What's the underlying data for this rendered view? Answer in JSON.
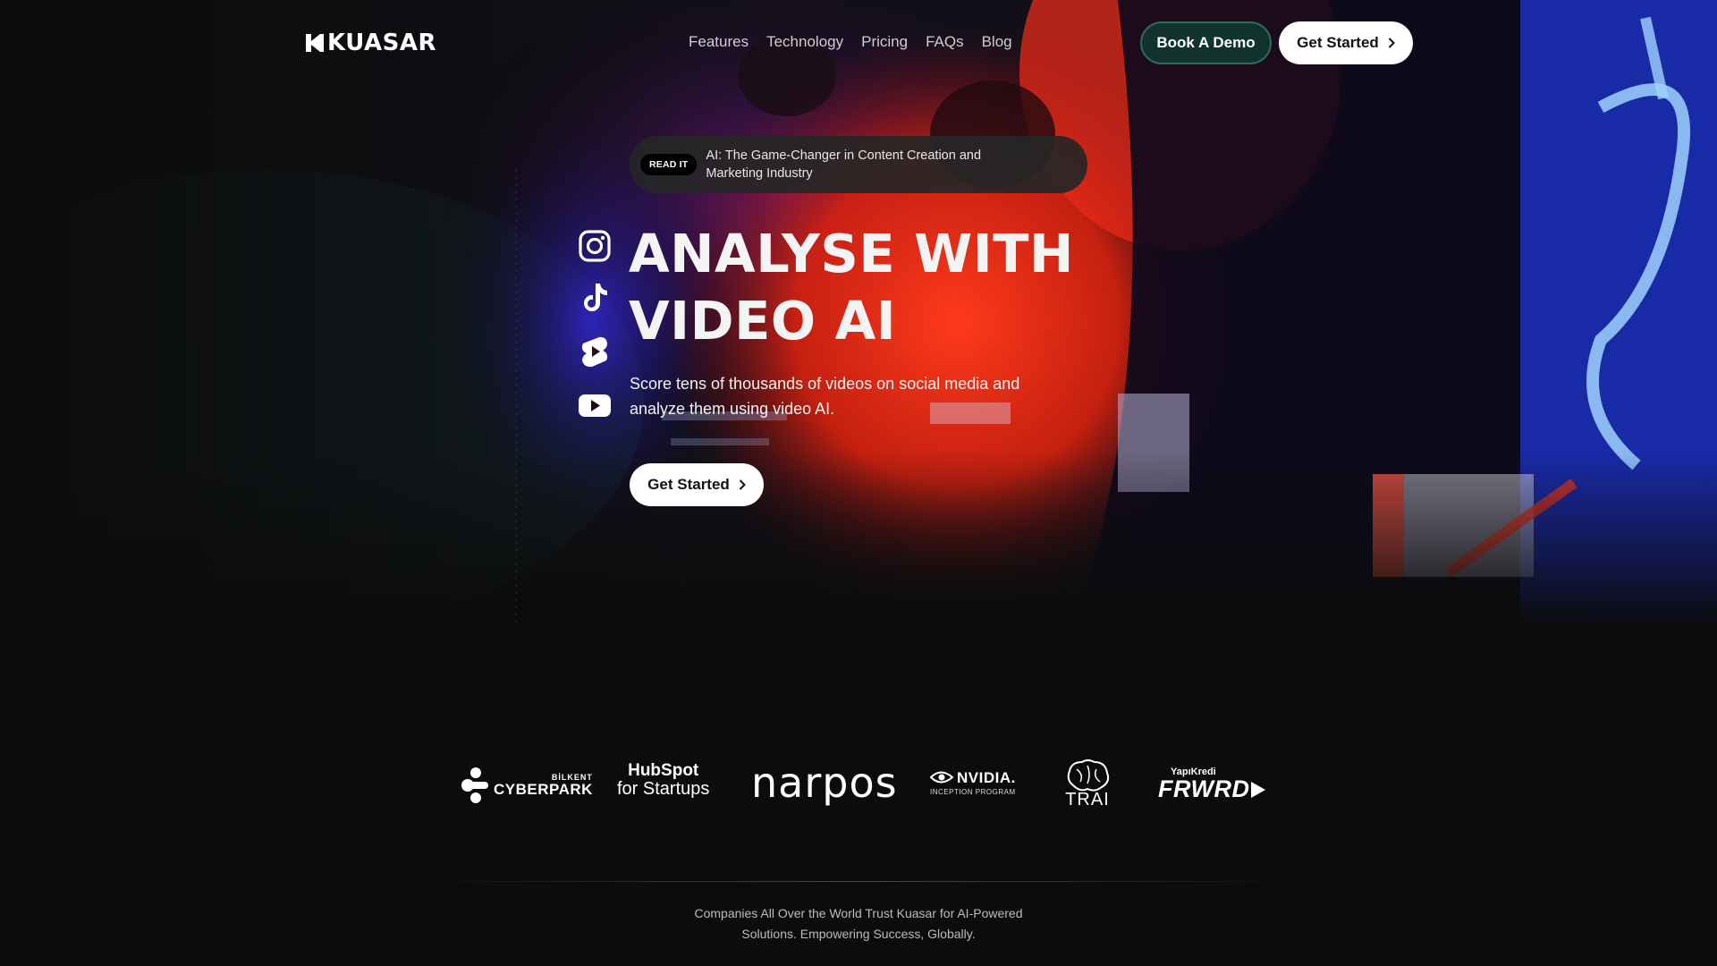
{
  "brand": {
    "name": "KUASAR"
  },
  "nav": {
    "links": [
      "Features",
      "Technology",
      "Pricing",
      "FAQs",
      "Blog"
    ],
    "demo_label": "Book A Demo",
    "start_label": "Get Started"
  },
  "announcement": {
    "badge": "READ IT",
    "text": "AI: The Game-Changer in Content Creation and Marketing Industry"
  },
  "hero": {
    "title_line1": "ANALYSE WITH",
    "title_line2": "VIDEO AI",
    "subtitle": "Score tens of thousands of videos on social media and analyze them using video AI.",
    "cta_label": "Get Started",
    "social_icons": [
      "instagram-icon",
      "tiktok-icon",
      "youtube-shorts-icon",
      "youtube-icon"
    ]
  },
  "partners": {
    "cyberpark_small": "BİLKENT",
    "cyberpark_big": "CYBERPARK",
    "hubspot_big": "HubSpot",
    "hubspot_small": "for Startups",
    "narpos": "narpos",
    "nvidia_big": "NVIDIA.",
    "nvidia_small": "INCEPTION PROGRAM",
    "trai": "TRAI",
    "frwrd_small": "YapıKredi",
    "frwrd_big": "FRWRD"
  },
  "footer": {
    "trust_text": "Companies All Over the World Trust Kuasar for AI-Powered Solutions. Empowering Success, Globally."
  },
  "colors": {
    "background": "#0c0c0c",
    "accent_red": "#e8341f",
    "accent_blue": "#2a4bff",
    "demo_button": "#10332c"
  }
}
